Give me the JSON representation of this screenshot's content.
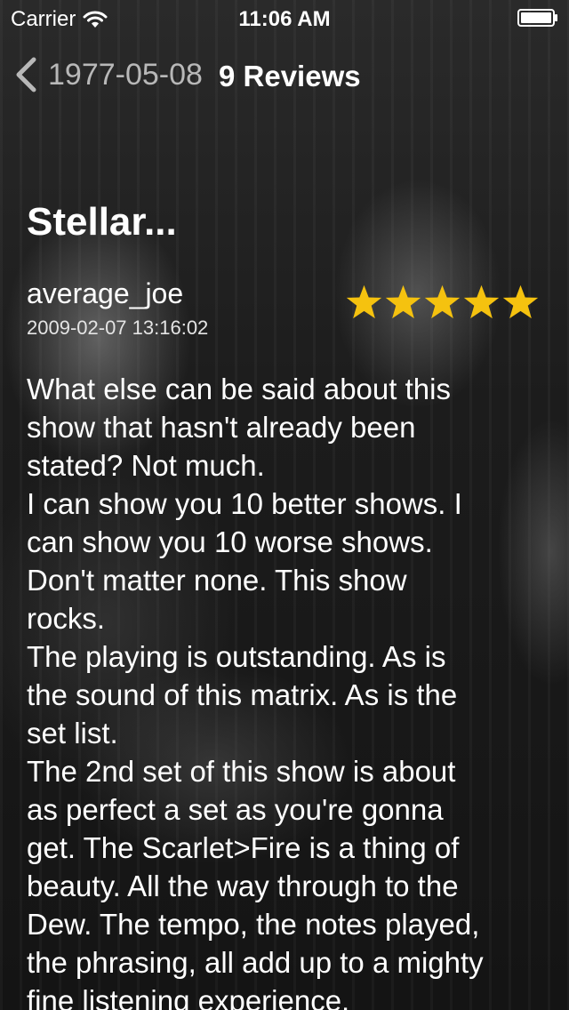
{
  "status_bar": {
    "carrier": "Carrier",
    "time": "11:06 AM"
  },
  "nav": {
    "back_label": "1977-05-08",
    "title": "9 Reviews"
  },
  "review": {
    "title": "Stellar...",
    "author": "average_joe",
    "date": "2009-02-07 13:16:02",
    "rating": 5,
    "rating_max": 5,
    "star_color": "#f5c20f",
    "body": "What else can be said about this\nshow that hasn't already been\nstated? Not much.\nI can show you 10 better shows. I\ncan show you 10 worse shows.\nDon't matter none. This show\nrocks.\nThe playing is outstanding. As is\nthe sound of this matrix. As is the\nset list.\nThe 2nd set of this show is about\nas perfect a set as you're gonna\nget. The Scarlet>Fire is a thing of\nbeauty. All the way through to the\nDew. The tempo, the notes played,\nthe phrasing, all add up to a mighty\nfine listening experience."
  }
}
